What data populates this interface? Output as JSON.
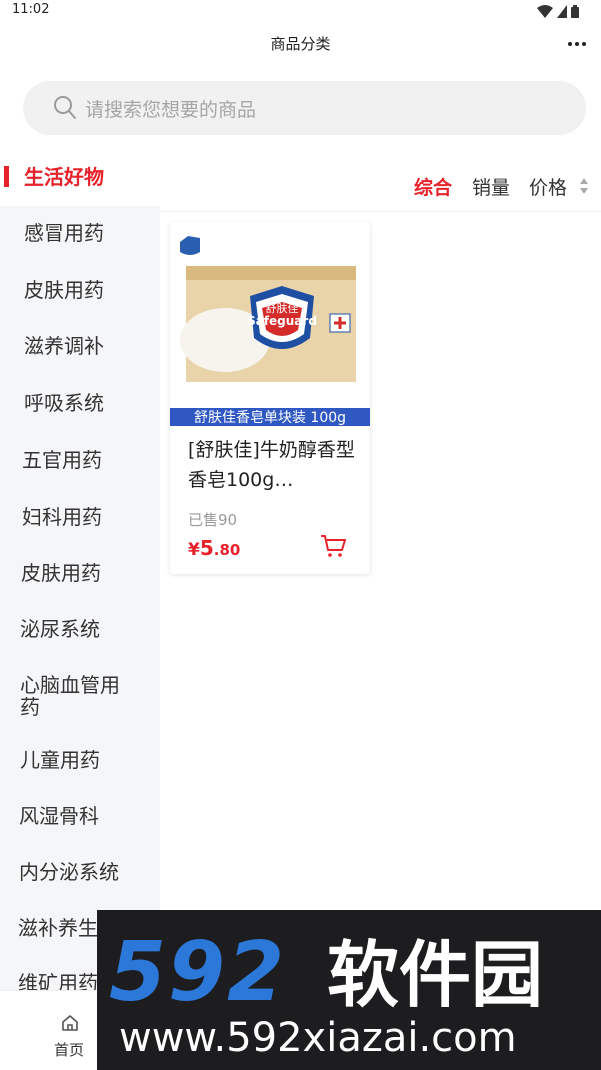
{
  "status_bar": {
    "time": "11:02"
  },
  "header": {
    "title": "商品分类"
  },
  "search": {
    "placeholder": "请搜索您想要的商品"
  },
  "sidebar": {
    "items": [
      {
        "label": "生活好物",
        "active": true
      },
      {
        "label": "感冒用药"
      },
      {
        "label": "皮肤用药"
      },
      {
        "label": "滋养调补"
      },
      {
        "label": "呼吸系统"
      },
      {
        "label": "五官用药"
      },
      {
        "label": "妇科用药"
      },
      {
        "label": "皮肤用药"
      },
      {
        "label": "泌尿系统"
      },
      {
        "label": "心脑血管用药"
      },
      {
        "label": "儿童用药"
      },
      {
        "label": "风湿骨科"
      },
      {
        "label": "内分泌系统"
      },
      {
        "label": "滋补养生"
      },
      {
        "label": "维矿用药"
      }
    ]
  },
  "sort": {
    "options": [
      {
        "label": "综合",
        "active": true
      },
      {
        "label": "销量"
      },
      {
        "label": "价格"
      }
    ]
  },
  "products": [
    {
      "banner": "舒肤佳香皂单块装  100g",
      "brand": "舒肤佳",
      "brand_en": "Safeguard",
      "name": "[舒肤佳]牛奶醇香型香皂100g…",
      "sold": "已售90",
      "price_symbol": "¥",
      "price_int": "5",
      "price_dec": ".80"
    }
  ],
  "tab_bar": {
    "home_label": "首页"
  },
  "watermark": {
    "big": "592",
    "cn": "软件园",
    "url": "www.592xiazai.com"
  },
  "colors": {
    "accent": "#e8222b",
    "sidebar_bg": "#f5f6f8",
    "search_bg": "#f1f1f1"
  }
}
